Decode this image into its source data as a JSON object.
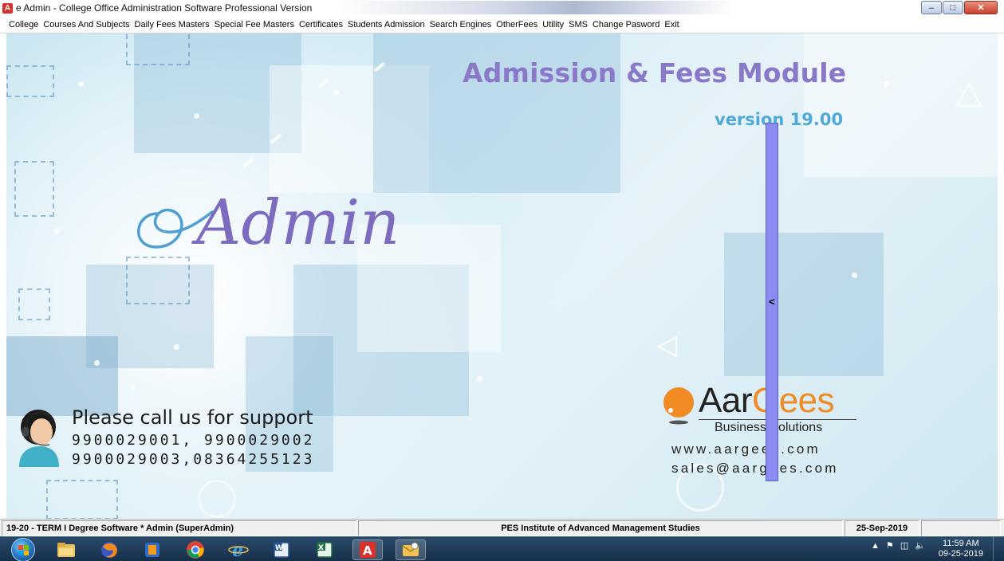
{
  "window": {
    "title": "e Admin - College Office Administration Software Professional Version",
    "app_icon": "A",
    "min_icon": "minimize-icon",
    "max_icon": "maximize-icon",
    "close_icon": "close-icon"
  },
  "menu": [
    "College",
    "Courses And Subjects",
    "Daily Fees Masters",
    "Special Fee Masters",
    "Certificates",
    "Students Admission",
    "Search Engines",
    "OtherFees",
    "Utility",
    "SMS",
    "Change Pasword",
    "Exit"
  ],
  "splash": {
    "title": "Admission & Fees Module",
    "version": "version 19.00",
    "logo_text": "Admin",
    "support_title": "Please call us for support",
    "phone_line1": "9900029001, 9900029002",
    "phone_line2": "9900029003,08364255123",
    "brand_part1": "Aar",
    "brand_part2": "Gees",
    "brand_tagline": "Business Solutions",
    "brand_website": "www.aargees.com",
    "brand_email": "sales@aargees.com"
  },
  "splitter": {
    "arrow": "<"
  },
  "statusbar": {
    "term": "19-20 - TERM I Degree Software * Admin (SuperAdmin)",
    "institute": "PES Institute of Advanced Management Studies",
    "date": "25-Sep-2019"
  },
  "taskbar": {
    "apps": [
      "start-orb",
      "file-explorer-icon",
      "firefox-icon",
      "media-player-icon",
      "chrome-icon",
      "internet-explorer-icon",
      "word-icon",
      "excel-icon",
      "eadmin-icon",
      "outlook-icon"
    ],
    "time": "11:59 AM",
    "date": "09-25-2019"
  },
  "colors": {
    "title": "#8a78c8",
    "version": "#4fa9d8",
    "brand_orange": "#f08a23",
    "splitter": "#8a8cf3"
  }
}
